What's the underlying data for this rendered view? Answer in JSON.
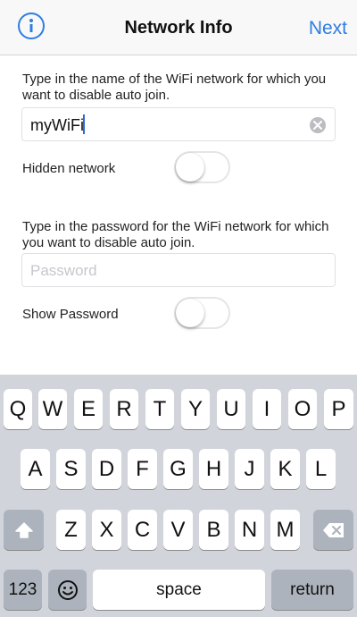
{
  "navbar": {
    "title": "Network Info",
    "next_label": "Next",
    "info_icon": "info-circle-icon"
  },
  "form": {
    "network_desc": "Type in the name of the WiFi network for which you want to disable auto join.",
    "network_value": "myWiFi",
    "hidden_label": "Hidden network",
    "hidden_on": false,
    "password_desc": "Type in the password for the WiFi network for which you want to disable auto join.",
    "password_placeholder": "Password",
    "show_password_label": "Show Password",
    "show_password_on": false
  },
  "keyboard": {
    "row1": [
      "Q",
      "W",
      "E",
      "R",
      "T",
      "Y",
      "U",
      "I",
      "O",
      "P"
    ],
    "row2": [
      "A",
      "S",
      "D",
      "F",
      "G",
      "H",
      "J",
      "K",
      "L"
    ],
    "row3": [
      "Z",
      "X",
      "C",
      "V",
      "B",
      "N",
      "M"
    ],
    "numbers_label": "123",
    "space_label": "space",
    "return_label": "return",
    "shift_icon": "shift-icon",
    "delete_icon": "delete-icon",
    "emoji_icon": "emoji-icon"
  },
  "colors": {
    "accent": "#2f7de1",
    "keyboard_bg": "#d1d4da",
    "dark_key": "#adb3bc"
  }
}
